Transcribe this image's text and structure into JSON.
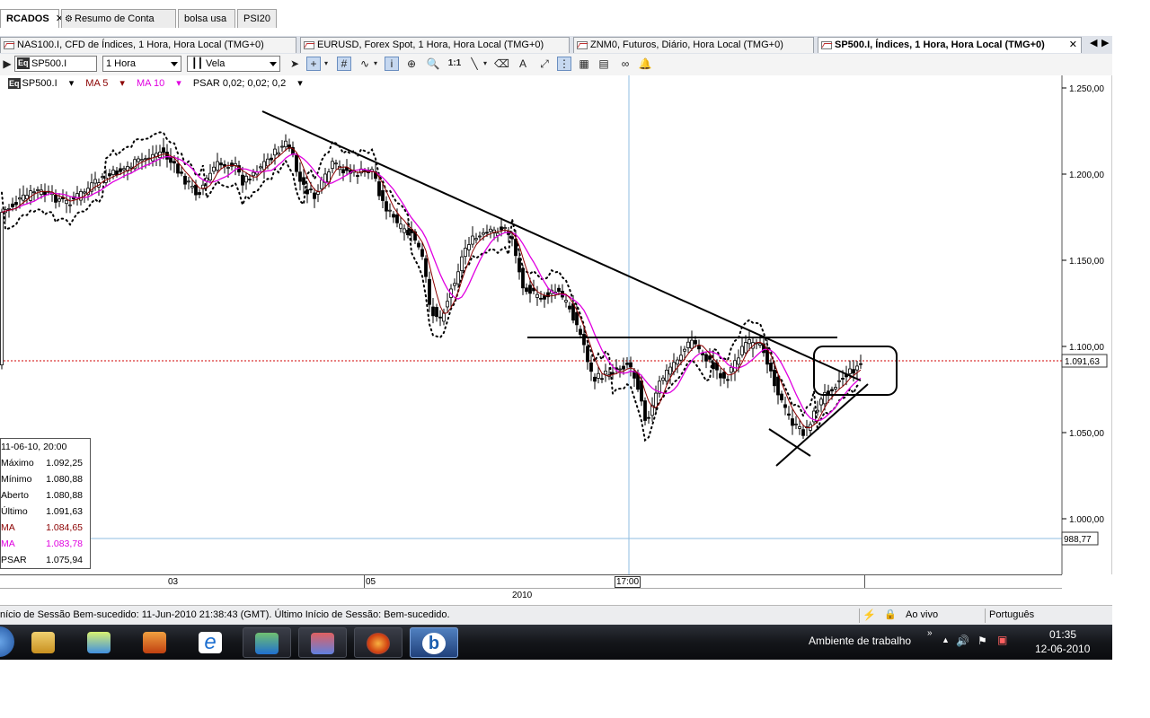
{
  "top_tabs": [
    {
      "label": "RCADOS",
      "active": true
    },
    {
      "label": "Resumo de Conta",
      "active": false
    },
    {
      "label": "bolsa usa",
      "active": false
    },
    {
      "label": "PSI20",
      "active": false
    }
  ],
  "chart_tabs": [
    {
      "label": "NAS100.I, CFD de Índices, 1 Hora, Hora Local (TMG+0)"
    },
    {
      "label": "EURUSD, Forex Spot, 1 Hora, Hora Local (TMG+0)"
    },
    {
      "label": "ZNM0, Futuros, Diário, Hora Local (TMG+0)"
    },
    {
      "label": "SP500.I, Índices, 1 Hora, Hora Local (TMG+0)"
    }
  ],
  "toolbar": {
    "symbol": "SP500.I",
    "interval": "1 Hora",
    "chart_style": "Vela",
    "zoom_label": "1:1"
  },
  "indicators": {
    "symbol": "SP500.I",
    "ma5": "MA 5",
    "ma10": "MA 10",
    "psar": "PSAR 0,02; 0,02; 0,2"
  },
  "price_axis": {
    "ticks": [
      "1.250,00",
      "1.200,00",
      "1.150,00",
      "1.100,00",
      "1.050,00",
      "1.000,00"
    ],
    "last_price_tag": "1.091,63",
    "cursor_price_tag": "988,77"
  },
  "info_box": {
    "date": "11-06-10, 20:00",
    "rows": [
      {
        "label": "Máximo",
        "value": "1.092,25"
      },
      {
        "label": "Mínimo",
        "value": "1.080,88"
      },
      {
        "label": "Aberto",
        "value": "1.080,88"
      },
      {
        "label": "Último",
        "value": "1.091,63"
      },
      {
        "label": "MA",
        "value": "1.084,65"
      },
      {
        "label": "MA",
        "value": "1.083,78"
      },
      {
        "label": "PSAR",
        "value": "1.075,94"
      }
    ]
  },
  "time_axis": {
    "labels": [
      "03",
      "05",
      "17:00"
    ],
    "year": "2010"
  },
  "status_bar": {
    "message": "nício de Sessão Bem-sucedido: 11-Jun-2010 21:38:43 (GMT). Último Início de Sessão: Bem-sucedido.",
    "live": "Ao vivo",
    "language": "Português"
  },
  "taskbar": {
    "desktop_label": "Ambiente de trabalho",
    "time": "01:35",
    "date": "12-06-2010"
  },
  "colors": {
    "ma5": "#8b0000",
    "ma10": "#e000e0",
    "last_price_line": "#d00000",
    "cursor_line": "#7fb2d8"
  }
}
